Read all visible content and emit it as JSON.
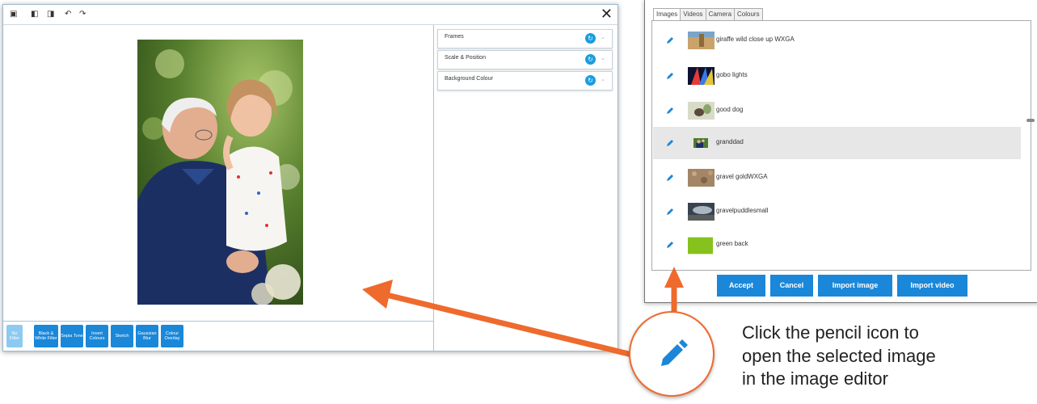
{
  "editor": {
    "close_glyph": "✕",
    "toolbar_icons": [
      "save-icon",
      "open-icon",
      "copy-icon",
      "undo-icon",
      "redo-icon"
    ],
    "accordions": [
      {
        "label": "Frames"
      },
      {
        "label": "Scale & Position"
      },
      {
        "label": "Background Colour"
      }
    ],
    "filters": [
      {
        "label": "No Filter"
      },
      {
        "label": "Black & White Filter"
      },
      {
        "label": "Sepia Tone"
      },
      {
        "label": "Invert Colours"
      },
      {
        "label": "Sketch"
      },
      {
        "label": "Gaussian Blur"
      },
      {
        "label": "Colour Overlay"
      }
    ]
  },
  "library": {
    "tabs": [
      {
        "label": "Images"
      },
      {
        "label": "Videos"
      },
      {
        "label": "Camera"
      },
      {
        "label": "Colours"
      }
    ],
    "images": [
      {
        "label": "giraffe wild close up WXGA"
      },
      {
        "label": "gobo lights"
      },
      {
        "label": "good dog"
      },
      {
        "label": "granddad"
      },
      {
        "label": "gravel goldWXGA"
      },
      {
        "label": "gravelpuddlesmall"
      },
      {
        "label": "green back"
      }
    ],
    "buttons": [
      {
        "label": "Accept"
      },
      {
        "label": "Cancel"
      },
      {
        "label": "Import image"
      },
      {
        "label": "Import video"
      }
    ]
  },
  "callout": {
    "caption_lines": [
      "Click the pencil icon to",
      "open the selected image",
      "in the image editor"
    ]
  },
  "colors": {
    "accent_blue": "#1a87d9",
    "arrow_orange": "#ee6a2d",
    "selected_row": "#e7e7e7"
  }
}
